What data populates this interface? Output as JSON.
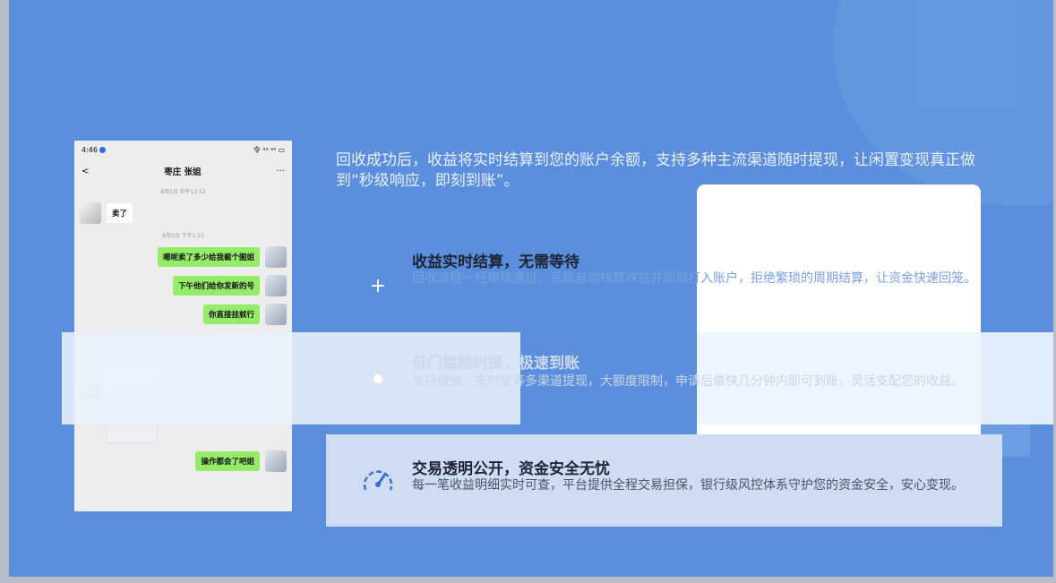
{
  "lead_text": "回收成功后，收益将实时结算到您的账户余额，支持多种主流渠道随时提现，让闲置变现真正做到“秒级响应，即刻到账”。",
  "phone": {
    "status_time": "4:46",
    "status_signal": "令 ᵃᵃ ᵃᵃ",
    "chat_title": "枣庄 张姐",
    "more": "···",
    "back": "<",
    "timestamps": [
      "8月5日 中午12:52",
      "8月5日 下午1:13"
    ],
    "messages": [
      {
        "side": "left",
        "text": "卖了"
      },
      {
        "side": "right",
        "text": "嗯呢卖了多少给我截个图姐"
      },
      {
        "side": "right",
        "text": "下午他们给你发新的号"
      },
      {
        "side": "right",
        "text": "你直接挂就行"
      },
      {
        "side": "right",
        "text": "操作都会了吧姐"
      }
    ]
  },
  "features": [
    {
      "icon": "plus-icon",
      "title": "收益实时结算，无需等待",
      "desc": "回收流程一经审核通过，系统自动核算收益并即刻打入账户，拒绝繁琐的周期结算，让资金快速回笼。"
    },
    {
      "icon": "dot-icon",
      "title": "低门槛随时提，极速到账",
      "desc": "支持微信、支付宝等多渠道提现，大额度限制，申请后最快几分钟内即可到账，灵活支配您的收益。"
    },
    {
      "icon": "speedometer-icon",
      "title": "交易透明公开，资金安全无忧",
      "desc": "每一笔收益明细实时可查，平台提供全程交易担保，银行级风控体系守护您的资金安全，安心变现。"
    }
  ],
  "colors": {
    "background": "#5b8fde",
    "highlight": "#cfdcf4",
    "bubble_green": "#95ec69",
    "accent_blue": "#3b6fd6"
  }
}
